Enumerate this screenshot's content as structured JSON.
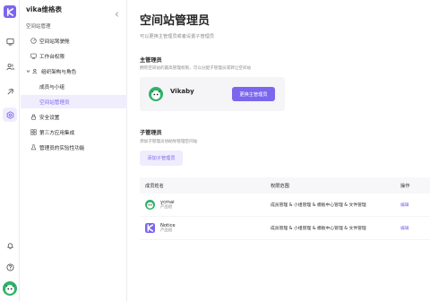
{
  "sidebar": {
    "space_name": "vika维格表",
    "section_label": "空间站管理",
    "items": [
      {
        "label": "空间站驾驶舱",
        "icon": "dashboard-icon"
      },
      {
        "label": "工作台权限",
        "icon": "workbench-icon"
      },
      {
        "label": "组织架构与角色",
        "icon": "org-icon"
      },
      {
        "label": "成员与小组"
      },
      {
        "label": "空间站管理员"
      },
      {
        "label": "安全设置",
        "icon": "lock-icon"
      },
      {
        "label": "第三方应用集成",
        "icon": "grid-icon"
      },
      {
        "label": "管理员的实验性功能",
        "icon": "lab-icon"
      }
    ]
  },
  "main": {
    "title": "空间站管理员",
    "description": "可以更换主管理员或者设置子管理员",
    "primary_admin": {
      "title": "主管理员",
      "description": "拥有空间站的最高管理权限，可以分配子管理员或转让空间站",
      "name": "Vikaby",
      "change_button": "更换主管理员"
    },
    "sub_admin": {
      "title": "子管理员",
      "description": "添加子管理员协助你管理空间站",
      "add_button": "添加子管理员"
    },
    "table": {
      "headers": [
        "成员姓名",
        "权限范围",
        "操作"
      ],
      "rows": [
        {
          "name": "ycmai",
          "dept": "产品组",
          "scope": "成员管理 & 小组管理 & 模板中心管理 & 文件管理",
          "action": "编辑"
        },
        {
          "name": "Notice",
          "dept": "产品组",
          "scope": "成员管理 & 小组管理 & 模板中心管理 & 文件管理",
          "action": "编辑"
        }
      ]
    }
  },
  "colors": {
    "accent": "#7b67ee",
    "accent_soft": "#efecfd",
    "avatar_green": "#2fb36a"
  }
}
